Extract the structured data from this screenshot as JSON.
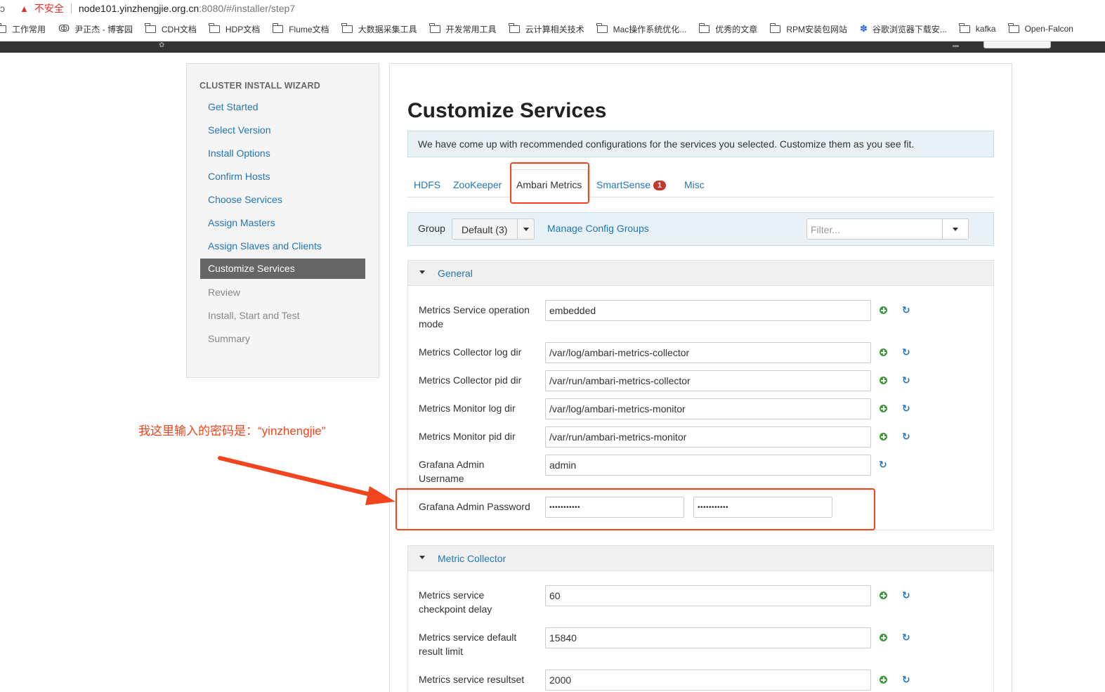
{
  "browser": {
    "insecure_label": "不安全",
    "url_host": "node101.yinzhengjie.org.cn",
    "url_path": ":8080/#/installer/step7",
    "bookmarks": [
      {
        "icon": "folder-icon",
        "label": "工作常用"
      },
      {
        "icon": "cnblogs-icon",
        "label": "尹正杰 - 博客园"
      },
      {
        "icon": "folder-icon",
        "label": "CDH文档"
      },
      {
        "icon": "folder-icon",
        "label": "HDP文档"
      },
      {
        "icon": "folder-icon",
        "label": "Flume文档"
      },
      {
        "icon": "folder-icon",
        "label": "大数据采集工具"
      },
      {
        "icon": "folder-icon",
        "label": "开发常用工具"
      },
      {
        "icon": "folder-icon",
        "label": "云计算相关技术"
      },
      {
        "icon": "folder-icon",
        "label": "Mac操作系统优化..."
      },
      {
        "icon": "folder-icon",
        "label": "优秀的文章"
      },
      {
        "icon": "folder-icon",
        "label": "RPM安装包网站"
      },
      {
        "icon": "baidu-paw-icon",
        "label": "谷歌浏览器下载安..."
      },
      {
        "icon": "folder-icon",
        "label": "kafka"
      },
      {
        "icon": "folder-icon",
        "label": "Open-Falcon"
      }
    ]
  },
  "sidebar": {
    "header": "CLUSTER INSTALL WIZARD",
    "items": [
      {
        "label": "Get Started",
        "state": "done"
      },
      {
        "label": "Select Version",
        "state": "done"
      },
      {
        "label": "Install Options",
        "state": "done"
      },
      {
        "label": "Confirm Hosts",
        "state": "done"
      },
      {
        "label": "Choose Services",
        "state": "done"
      },
      {
        "label": "Assign Masters",
        "state": "done"
      },
      {
        "label": "Assign Slaves and Clients",
        "state": "done"
      },
      {
        "label": "Customize Services",
        "state": "active"
      },
      {
        "label": "Review",
        "state": "future"
      },
      {
        "label": "Install, Start and Test",
        "state": "future"
      },
      {
        "label": "Summary",
        "state": "future"
      }
    ]
  },
  "main": {
    "title": "Customize Services",
    "info": "We have come up with recommended configurations for the services you selected. Customize them as you see fit.",
    "tabs": [
      {
        "label": "HDFS"
      },
      {
        "label": "ZooKeeper"
      },
      {
        "label": "Ambari Metrics",
        "active": true
      },
      {
        "label": "SmartSense",
        "badge": "1"
      },
      {
        "label": "Misc"
      }
    ],
    "group": {
      "label": "Group",
      "selected": "Default (3)",
      "manage_link": "Manage Config Groups",
      "filter_placeholder": "Filter..."
    },
    "sections": {
      "general": {
        "title": "General",
        "rows": [
          {
            "label": "Metrics Service operation mode",
            "value": "embedded"
          },
          {
            "label": "Metrics Collector log dir",
            "value": "/var/log/ambari-metrics-collector"
          },
          {
            "label": "Metrics Collector pid dir",
            "value": "/var/run/ambari-metrics-collector"
          },
          {
            "label": "Metrics Monitor log dir",
            "value": "/var/log/ambari-metrics-monitor"
          },
          {
            "label": "Metrics Monitor pid dir",
            "value": "/var/run/ambari-metrics-monitor"
          },
          {
            "label": "Grafana Admin Username",
            "value": "admin"
          }
        ],
        "password": {
          "label": "Grafana Admin Password",
          "masked": "•••••••••••",
          "confirm_masked": "•••••••••••"
        }
      },
      "collector": {
        "title": "Metric Collector",
        "rows": [
          {
            "label": "Metrics service checkpoint delay",
            "value": "60"
          },
          {
            "label": "Metrics service default result limit",
            "value": "15840"
          },
          {
            "label": "Metrics service resultset",
            "value": "2000"
          }
        ]
      }
    }
  },
  "annotation": {
    "text": "我这里输入的密码是：“yinzhengjie”",
    "color": "#f2441d"
  }
}
